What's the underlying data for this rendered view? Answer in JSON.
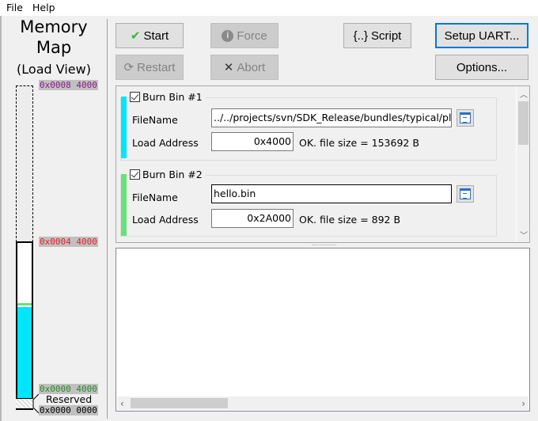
{
  "menu": {
    "file": "File",
    "help": "Help"
  },
  "memory_map": {
    "title_line1": "Memory",
    "title_line2": "Map",
    "subtitle": "(Load View)",
    "addresses": {
      "top": "0x0008 4000",
      "mid": "0x0004 4000",
      "low": "0x0000 4000",
      "zero": "0x0000 0000"
    },
    "reserved_label": "Reserved",
    "colors": {
      "top": "#8b1a8b",
      "mid": "#e8202a",
      "low": "#2a8a2a",
      "bin1": "#00e6ff",
      "bin2": "#66e27a"
    }
  },
  "toolbar": {
    "start": "Start",
    "force": "Force",
    "restart": "Restart",
    "abort": "Abort",
    "script_icon": "{..}",
    "script": "Script",
    "setup_uart": "Setup UART...",
    "options": "Options..."
  },
  "bins": [
    {
      "title": "Burn Bin #1",
      "checked": true,
      "filename_label": "FileName",
      "filename": "../../projects/svn/SDK_Release/bundles/typical/platfo",
      "load_address_label": "Load Address",
      "load_address": "0x4000",
      "status": "OK. file size = 153692 B"
    },
    {
      "title": "Burn Bin #2",
      "checked": true,
      "filename_label": "FileName",
      "filename": "hello.bin",
      "load_address_label": "Load Address",
      "load_address": "0x2A000",
      "status": "OK. file size = 892 B"
    }
  ],
  "log": {
    "text": ""
  }
}
